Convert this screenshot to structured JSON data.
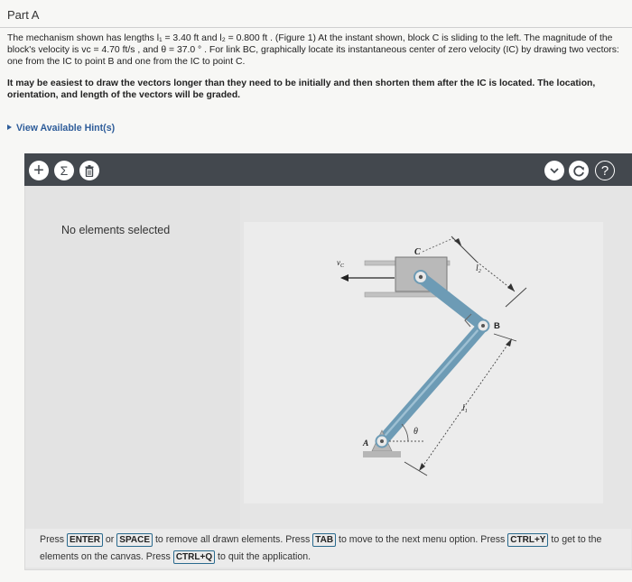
{
  "part": {
    "title": "Part A"
  },
  "problem": {
    "text": "The mechanism shown has lengths l₁ = 3.40 ft and l₂ = 0.800 ft . (Figure 1) At the instant shown, block C is sliding to the left. The magnitude of the block's velocity is vᴄ = 4.70 ft/s , and θ = 37.0 ° . For link BC, graphically locate its instantaneous center of zero velocity (IC) by drawing two vectors: one from the IC to point B and one from the IC to point C.",
    "emphasis": "It may be easiest to draw the vectors longer than they need to be initially and then shorten them after the IC is located. The location, orientation, and length of the vectors will be graded.",
    "hint_link": "View Available Hint(s)"
  },
  "toolbar": {
    "add_icon": "+",
    "sigma_icon": "Σ",
    "help_icon": "?"
  },
  "panel": {
    "status": "No elements selected"
  },
  "figure": {
    "labels": {
      "vc": "v",
      "vc_sub": "C",
      "c": "C",
      "b": "B",
      "a": "A",
      "l1": "l",
      "l1_sub": "1",
      "l2": "l",
      "l2_sub": "2",
      "theta": "θ"
    },
    "colors": {
      "link": "#6d9bb5",
      "block": "#b9b9b9",
      "ground": "#b6b6b6"
    }
  },
  "footer": {
    "t1": "Press",
    "k1": "ENTER",
    "t2": "or",
    "k2": "SPACE",
    "t3": "to remove all drawn elements. Press",
    "k3": "TAB",
    "t4": "to move to the next menu option. Press",
    "k4": "CTRL+Y",
    "t5": "to get to the elements on the canvas. Press",
    "k5": "CTRL+Q",
    "t6": "to quit the application."
  }
}
